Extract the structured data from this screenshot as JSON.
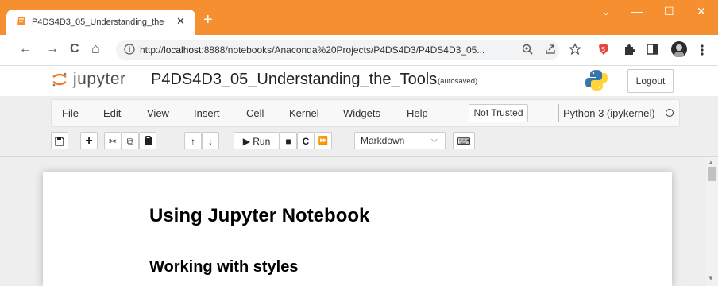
{
  "browser": {
    "tab_title": "P4DS4D3_05_Understanding_the",
    "tab_close": "✕",
    "new_tab": "+",
    "window_controls": {
      "chevron": "⌄",
      "minimize": "—",
      "maximize": "☐",
      "close": "✕"
    },
    "nav": {
      "back": "←",
      "forward": "→",
      "reload": "C",
      "home": "⌂"
    },
    "url_prefix": "http://",
    "url_host": "localhost",
    "url_rest": ":8888/notebooks/Anaconda%20Projects/P4DS4D3/P4DS4D3_05...",
    "omnibox_icons": [
      "zoom-icon",
      "share-icon",
      "star-icon"
    ],
    "extension_icons": [
      "shield-extension-icon",
      "puzzle-icon",
      "sidepanel-icon",
      "profile-avatar",
      "kebab-menu-icon"
    ],
    "accent_color": "#f58f2f"
  },
  "jupyter": {
    "logo_text": "jupyter",
    "notebook_title": "P4DS4D3_05_Understanding_the_Tools",
    "autosave_status": "(autosaved)",
    "logout_label": "Logout",
    "menu": [
      "File",
      "Edit",
      "View",
      "Insert",
      "Cell",
      "Kernel",
      "Widgets",
      "Help"
    ],
    "trust_status": "Not Trusted",
    "kernel_name": "Python 3 (ipykernel)",
    "toolbar": {
      "save": "🖫",
      "add": "+",
      "cut": "✂",
      "copy": "⧉",
      "paste": "📋",
      "move_up": "↑",
      "move_down": "↓",
      "run_label": "▶ Run",
      "interrupt": "■",
      "restart": "C",
      "restart_run_all": "⏩",
      "cell_type": "Markdown",
      "command_palette": "⌨"
    }
  },
  "notebook": {
    "heading1": "Using Jupyter Notebook",
    "heading2": "Working with styles"
  }
}
